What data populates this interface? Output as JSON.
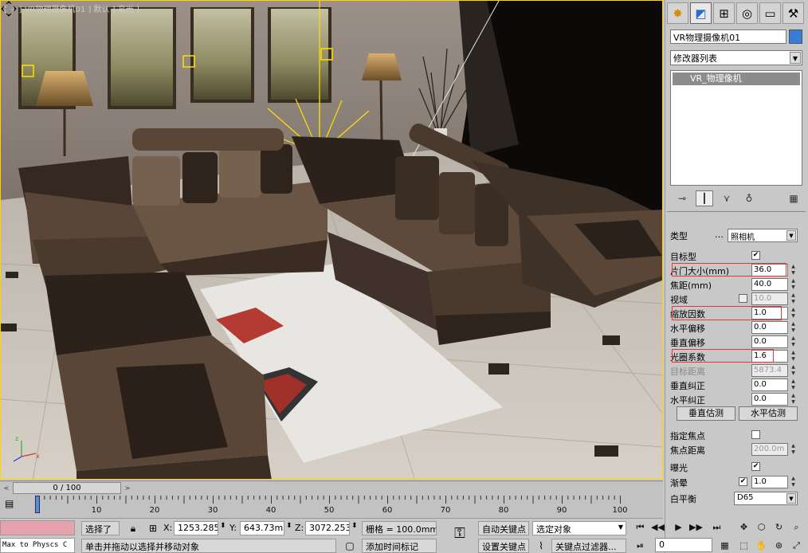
{
  "viewport": {
    "label": "[ + ] VR物理摄像机01 ] 默认 ] 高光 ]"
  },
  "command_panel": {
    "tabs": [
      {
        "name": "create",
        "glyph": "✸"
      },
      {
        "name": "modify",
        "glyph": "◩"
      },
      {
        "name": "hierarchy",
        "glyph": "⊞"
      },
      {
        "name": "motion",
        "glyph": "◎"
      },
      {
        "name": "display",
        "glyph": "▭"
      },
      {
        "name": "utilities",
        "glyph": "⚒"
      }
    ],
    "object_name": "VR物理摄像机01",
    "object_color": "#3a7bd5",
    "modifier_list": "修改器列表",
    "stack_item": "VR_物理像机",
    "params": {
      "type_label": "类型",
      "type_value": "照相机",
      "target_label": "目标型",
      "target_checked": "✔",
      "film_gate_label": "片门大小(mm)",
      "film_gate_value": "36.0",
      "focal_label": "焦距(mm)",
      "focal_value": "40.0",
      "fov_label": "视域",
      "fov_value": "10.0",
      "zoom_label": "缩放因数",
      "zoom_value": "1.0",
      "hshift_label": "水平偏移",
      "hshift_value": "0.0",
      "vshift_label": "垂直偏移",
      "vshift_value": "0.0",
      "fnumber_label": "光圈系数",
      "fnumber_value": "1.6",
      "target_dist_label": "目标距离",
      "target_dist_value": "5873.4",
      "vtilt_label": "垂直纠正",
      "vtilt_value": "0.0",
      "htilt_label": "水平纠正",
      "htilt_value": "0.0",
      "guess_vert_btn": "垂直估测",
      "guess_horiz_btn": "水平估测",
      "spec_focus_label": "指定焦点",
      "focus_dist_label": "焦点距离",
      "focus_dist_value": "200.0m",
      "exposure_label": "曝光",
      "exposure_checked": "✔",
      "vignette_label": "渐晕",
      "vignette_checked": "✔",
      "vignette_value": "1.0",
      "wb_label": "白平衡",
      "wb_value": "D65"
    }
  },
  "time_slider": {
    "position": "0 / 100",
    "prev": "<",
    "next": ">"
  },
  "trackbar": {
    "ticks": [
      "10",
      "20",
      "30",
      "40",
      "50",
      "60",
      "70",
      "80",
      "90",
      "100"
    ]
  },
  "status": {
    "maxscript_text": "Max to Physcs C",
    "selected": "选择了",
    "prompt": "单击并拖动以选择并移动对象",
    "x_label": "X:",
    "x_value": "1253.285m",
    "y_label": "Y:",
    "y_value": "643.73mm",
    "z_label": "Z:",
    "z_value": "3072.253m",
    "grid": "栅格 = 100.0mm",
    "add_time_tag": "添加时间标记",
    "auto_key": "自动关键点",
    "set_key": "设置关键点",
    "selection_set": "选定对象",
    "key_filters": "关键点过滤器...",
    "frame": "0"
  }
}
